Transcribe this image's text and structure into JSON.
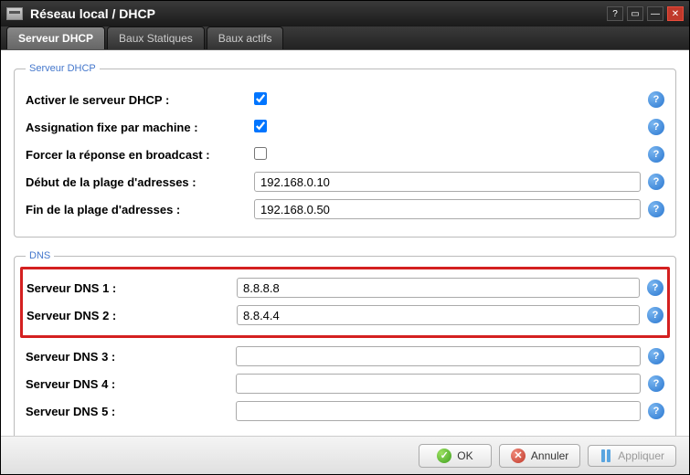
{
  "window": {
    "title": "Réseau local / DHCP"
  },
  "tabs": [
    {
      "label": "Serveur DHCP",
      "active": true
    },
    {
      "label": "Baux Statiques",
      "active": false
    },
    {
      "label": "Baux actifs",
      "active": false
    }
  ],
  "groups": {
    "dhcp": {
      "legend": "Serveur DHCP",
      "rows": {
        "enable": {
          "label": "Activer le serveur DHCP :",
          "checked": true
        },
        "fixed": {
          "label": "Assignation fixe par machine :",
          "checked": true
        },
        "broadcast": {
          "label": "Forcer la réponse en broadcast :",
          "checked": false
        },
        "start": {
          "label": "Début de la plage d'adresses :",
          "value": "192.168.0.10"
        },
        "end": {
          "label": "Fin de la plage d'adresses :",
          "value": "192.168.0.50"
        }
      }
    },
    "dns": {
      "legend": "DNS",
      "rows": {
        "dns1": {
          "label": "Serveur DNS 1 :",
          "value": "8.8.8.8"
        },
        "dns2": {
          "label": "Serveur DNS 2 :",
          "value": "8.8.4.4"
        },
        "dns3": {
          "label": "Serveur DNS 3 :",
          "value": ""
        },
        "dns4": {
          "label": "Serveur DNS 4 :",
          "value": ""
        },
        "dns5": {
          "label": "Serveur DNS 5 :",
          "value": ""
        }
      }
    }
  },
  "footer": {
    "ok": "OK",
    "cancel": "Annuler",
    "apply": "Appliquer"
  }
}
